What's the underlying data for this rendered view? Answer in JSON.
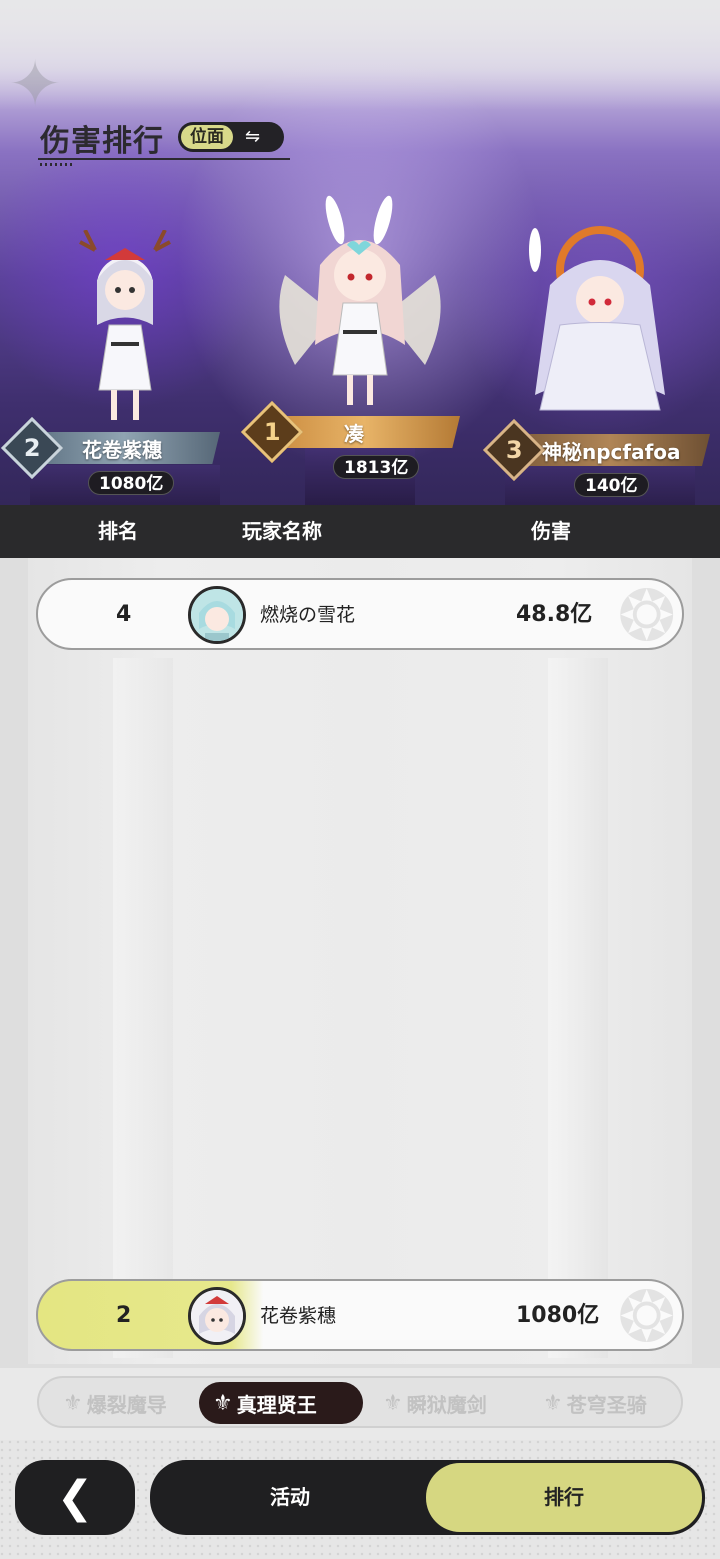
{
  "header": {
    "title": "伤害排行",
    "scope_label": "位面",
    "swap_icon": "swap-icon"
  },
  "podium": [
    {
      "rank": "1",
      "name": "凑",
      "damage": "1813亿"
    },
    {
      "rank": "2",
      "name": "花卷紫穗",
      "damage": "1080亿"
    },
    {
      "rank": "3",
      "name": "神秘npcfafoa",
      "damage": "140亿"
    }
  ],
  "table": {
    "columns": [
      "排名",
      "玩家名称",
      "伤害"
    ],
    "rows": [
      {
        "rank": "4",
        "name": "燃烧の雪花",
        "damage": "48.8亿",
        "avatar": "avatar-icon"
      }
    ],
    "self": {
      "rank": "2",
      "name": "花卷紫穗",
      "damage": "1080亿",
      "avatar": "avatar-icon"
    }
  },
  "class_tabs": [
    {
      "label": "爆裂魔导",
      "icon": "emblem-icon",
      "active": false
    },
    {
      "label": "真理贤王",
      "icon": "emblem-icon",
      "active": true
    },
    {
      "label": "瞬狱魔剑",
      "icon": "emblem-icon",
      "active": false
    },
    {
      "label": "苍穹圣骑",
      "icon": "emblem-icon",
      "active": false
    }
  ],
  "bottom_nav": {
    "back_icon": "chevron-left-icon",
    "tabs": [
      {
        "label": "活动",
        "active": false
      },
      {
        "label": "排行",
        "active": true
      }
    ]
  },
  "colors": {
    "accent": "#d6d781",
    "dark": "#1f1f21",
    "gold": "#e8b468",
    "silver": "#90a4b2",
    "bronze": "#b08556"
  }
}
